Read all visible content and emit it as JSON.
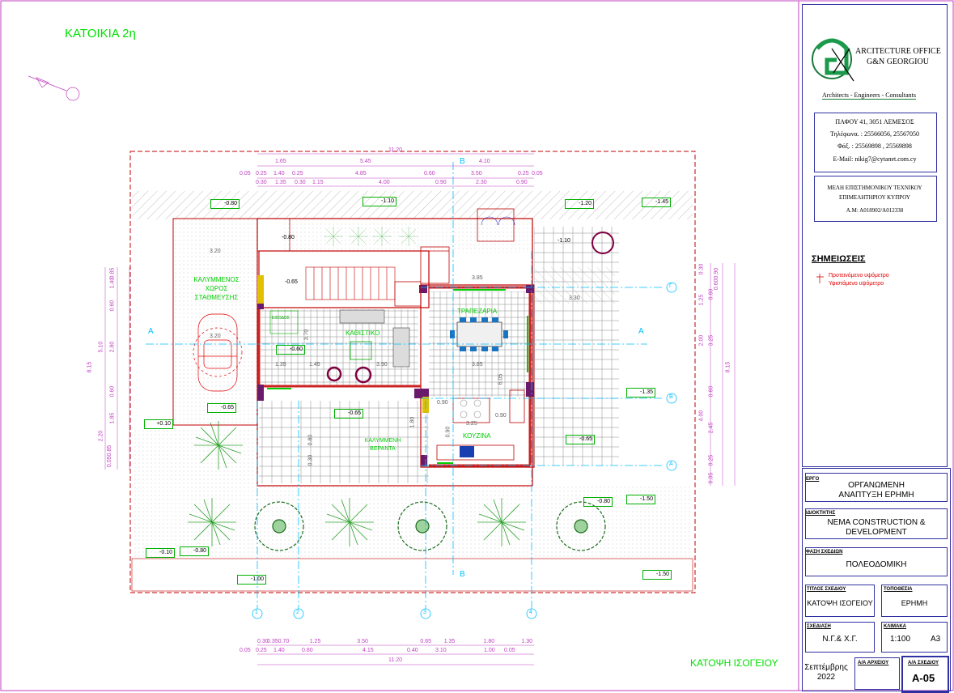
{
  "drawing": {
    "heading": "ΚΑΤΟΙΚΙΑ 2η",
    "view_title": "ΚΑΤΟΨΗ ΙΣΟΓΕΙΟΥ",
    "rooms": {
      "parking": "ΚΑΛΥΜΜΕΝΟΣ ΧΩΡΟΣ ΣΤΑΘΜΕΥΣΗΣ",
      "living": "ΚΑΘΙΣΤΙΚΟ",
      "dining": "ΤΡΑΠΕΖΑΡΙΑ",
      "kitchen": "ΚΟΥΖΙΝΑ",
      "veranda": "ΚΑΛΥΜΜΕΝΗ ΒΕΡΑΝΤΑ",
      "entrance": "ΕΙΣΟΔΟΣ"
    },
    "sections": {
      "a": "A",
      "b": "B"
    },
    "axes": [
      "1",
      "2",
      "3",
      "4"
    ],
    "grid_letters": [
      "Γ",
      "Β",
      "Α"
    ],
    "levels": [
      "-0.80",
      "-1.10",
      "-1.20",
      "-1.45",
      "-0.60",
      "-0.65",
      "+0.10",
      "-0.65",
      "-1.35",
      "-0.65",
      "-0.80",
      "-1.50",
      "-0.10",
      "-0.80",
      "-1.00",
      "-1.50"
    ],
    "top_dims_row1": [
      "1.65",
      "5.45",
      "4.10"
    ],
    "top_dims_row2": [
      "0.05",
      "0.25",
      "1.40",
      "0.25",
      "4.85",
      "0.60",
      "3.50",
      "0.25",
      "0.05"
    ],
    "top_dims_row3": [
      "0.30",
      "1.35",
      "0.30",
      "1.15",
      "4.00",
      "0.90",
      "2.30",
      "0.90"
    ],
    "top_total": "11.20",
    "bottom_dims_row1": [
      "0.30",
      "0.35",
      "0.70",
      "1.25",
      "3.50",
      "0.65",
      "1.35",
      "1.80",
      "1.30"
    ],
    "bottom_dims_row2": [
      "0.05",
      "0.25",
      "1.40",
      "0.80",
      "4.15",
      "0.40",
      "3.10",
      "1.00",
      "0.05"
    ],
    "bottom_total": "11.20",
    "left_dims": [
      "0.85",
      "1.40",
      "0.60",
      "2.80",
      "5.10",
      "0.60",
      "1.85",
      "2.20",
      "0.050.85",
      "8.15"
    ],
    "right_dims": [
      "0.30",
      "0.600.90",
      "1.25",
      "0.60",
      "2.00",
      "3.25",
      "0.60",
      "4.00",
      "2.45",
      "0.25",
      "0.05",
      "8.15"
    ],
    "inner_dims": [
      "3.20",
      "3.20",
      "1.35",
      "1.45",
      "3.90",
      "3.85",
      "3.85",
      "3.70",
      "0.90",
      "0.90",
      "3.25",
      "1.80",
      "0.90",
      "6.05",
      "3.30",
      "0.80",
      "0.30"
    ],
    "small_levels": [
      "-0.80",
      "-0.65",
      "-1.10"
    ]
  },
  "titleblock": {
    "office_name": "ARCITECTURE OFFICE",
    "office_name2": "G&N GEORGIOU",
    "tagline": "Architects - Engineers - Consultants",
    "address": "ΠΑΦΟΥ 41, 3051 ΛΕΜΕΣΟΣ",
    "phones": "Τηλέφωνα. : 25566056, 25567050",
    "fax": "Φάξ. : 25569898 , 25569898",
    "email": "E-Mail: nikig7@cytanet.com.cy",
    "member_line1": "ΜΕΛΗ ΕΠΙΣΤΗΜΟΝΙΚΟΥ ΤΕΧΝΙΚΟΥ",
    "member_line2": "ΕΠΙΜΕΛΗΤΗΡΙΟΥ ΚΥΠΡΟΥ",
    "member_line3": "Α.Μ: Α018902/Α012338",
    "notes_label": "ΣΗΜΕΙΩΣΕΙΣ",
    "note_proposed": "Προτεινόμενο υψόμετρο",
    "note_existing": "Υφιστάμενο υψόμετρο",
    "project_label": "ΕΡΓΟ",
    "project_value": "ΟΡΓΑΝΩΜΕΝΗ ΑΝΑΠΤΥΞΗ ΕΡΗΜΗ",
    "owner_label": "ΙΔΙΟΚΤΗΤΗΣ",
    "owner_value": "NEMA CONSTRUCTION & DEVELOPMENT",
    "phase_label": "ΦΑΣΗ ΣΧΕΔΙΩΝ",
    "phase_value": "ΠΟΛΕΟΔΟΜΙΚΗ",
    "title_label": "ΤΙΤΛΟΣ ΣΧΕΔΙΟΥ",
    "title_value": "ΚΑΤΟΨΗ ΙΣΟΓΕΙΟΥ",
    "location_label": "ΤΟΠΟΘΕΣΙΑ",
    "location_value": "ΕΡΗΜΗ",
    "drawn_label": "ΣΧΕΔΙΑΣΗ",
    "drawn_value": "Ν.Γ.& Χ.Γ.",
    "scale_label": "ΚΛΙΜΑΚΑ",
    "scale_value": "1:100",
    "paper_value": "A3",
    "date_value": "Σεπτέμβρης 2022",
    "archive_label": "Α/Α ΑΡΧΕΙΟΥ",
    "sheet_label": "Α/Α ΣΧΕΔΙΟΥ",
    "sheet_value": "A-05"
  },
  "colors": {
    "frame": "#c040c0",
    "titleblock_border": "#3030a0",
    "dim_line": "#c040c0",
    "plot": "#c00000",
    "axis": "#00bfff",
    "text_green": "#00e000",
    "hatch": "#a0a0a0",
    "level_tag": "#00b000"
  }
}
